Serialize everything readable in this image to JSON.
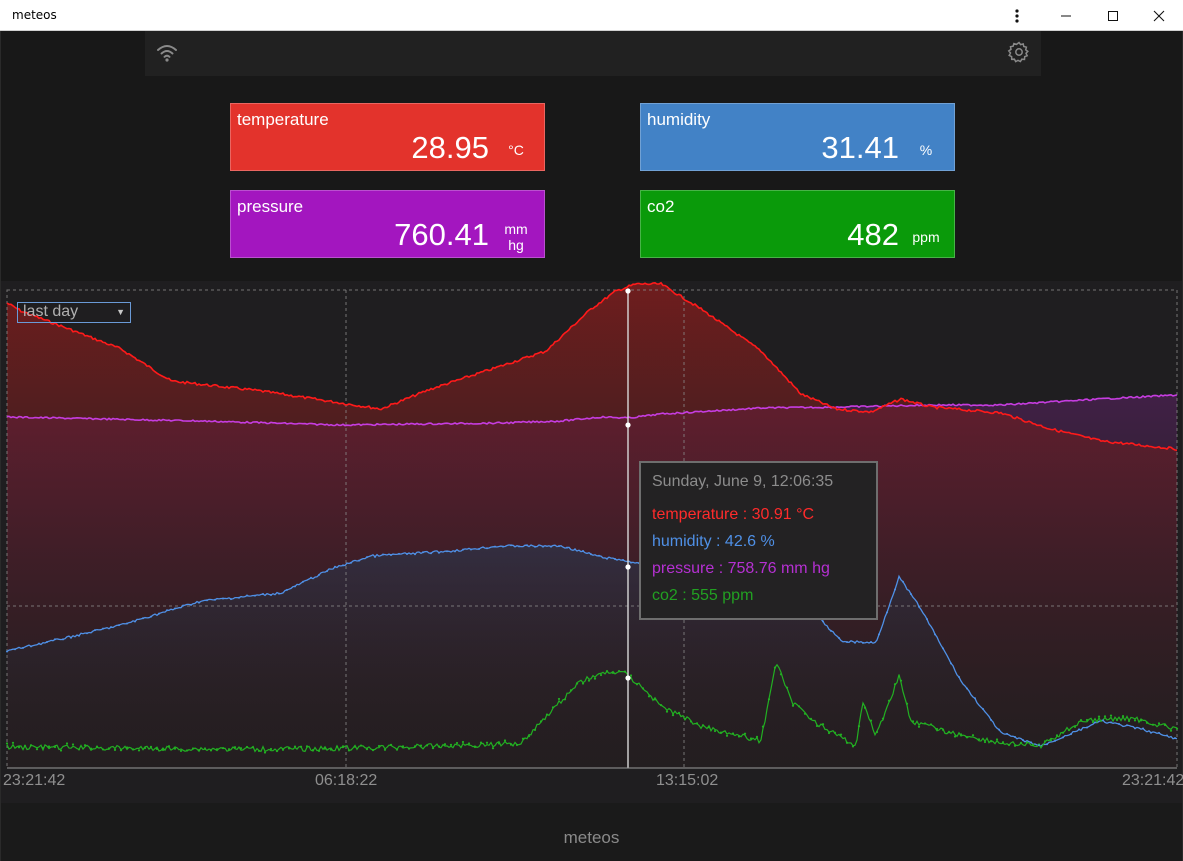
{
  "window": {
    "title": "meteos",
    "menu_icon": "kebab-icon",
    "minimize_icon": "minimize-icon",
    "maximize_icon": "maximize-icon",
    "close_icon": "close-icon"
  },
  "toolbar": {
    "connection_icon": "wifi-icon",
    "settings_icon": "gear-icon"
  },
  "cards": {
    "temperature": {
      "label": "temperature",
      "value": "28.95",
      "unit": "°C",
      "color": "#e3332c"
    },
    "humidity": {
      "label": "humidity",
      "value": "31.41",
      "unit": "%",
      "color": "#4282c6"
    },
    "pressure": {
      "label": "pressure",
      "value": "760.41",
      "unit_top": "mm",
      "unit_bottom": "hg",
      "color": "#a316bf"
    },
    "co2": {
      "label": "co2",
      "value": "482",
      "unit": "ppm",
      "color": "#0a9a0a"
    }
  },
  "chart": {
    "range_select": {
      "selected": "last day"
    },
    "x_ticks": [
      "23:21:42",
      "06:18:22",
      "13:15:02",
      "23:21:42"
    ],
    "tooltip": {
      "header": "Sunday, June 9, 12:06:35",
      "temperature": "temperature : 30.91 °C",
      "humidity": "humidity : 42.6 %",
      "pressure": "pressure : 758.76 mm hg",
      "co2": "co2 : 555 ppm"
    },
    "colors": {
      "temperature": "#ff1a1a",
      "humidity": "#4f90e6",
      "pressure": "#c63de0",
      "co2": "#22b022",
      "grid": "#8a8a8a"
    }
  },
  "footer": {
    "app_name": "meteos"
  }
}
